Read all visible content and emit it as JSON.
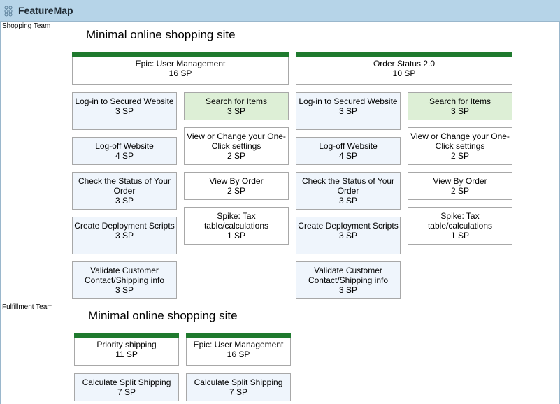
{
  "app": {
    "title": "FeatureMap",
    "icon": "featuremap-grid-icon"
  },
  "teams": [
    {
      "label": "Shopping Team",
      "release_title": "Minimal online shopping site",
      "epics": [
        {
          "name": "Epic: User Management",
          "sp": "16 SP",
          "left_column": [
            {
              "name": "Log-in to Secured Website",
              "sp": "3 SP"
            },
            {
              "name": "Log-off Website",
              "sp": "4 SP"
            },
            {
              "name": "Check the Status of Your Order",
              "sp": "3 SP"
            },
            {
              "name": "Create Deployment Scripts",
              "sp": "3 SP"
            },
            {
              "name": "Validate Customer Contact/Shipping info",
              "sp": "3 SP"
            }
          ],
          "right_column": [
            {
              "name": "Search for Items",
              "sp": "3 SP"
            },
            {
              "name": "View or Change your One-Click settings",
              "sp": "2 SP"
            },
            {
              "name": "View By Order",
              "sp": "2 SP"
            },
            {
              "name": "Spike: Tax table/calculations",
              "sp": "1 SP"
            }
          ]
        },
        {
          "name": "Order Status 2.0",
          "sp": "10 SP",
          "left_column": [
            {
              "name": "Log-in to Secured Website",
              "sp": "3 SP"
            },
            {
              "name": "Log-off Website",
              "sp": "4 SP"
            },
            {
              "name": "Check the Status of Your Order",
              "sp": "3 SP"
            },
            {
              "name": "Create Deployment Scripts",
              "sp": "3 SP"
            },
            {
              "name": "Validate Customer Contact/Shipping info",
              "sp": "3 SP"
            }
          ],
          "right_column": [
            {
              "name": "Search for Items",
              "sp": "3 SP"
            },
            {
              "name": "View or Change your One-Click settings",
              "sp": "2 SP"
            },
            {
              "name": "View By Order",
              "sp": "2 SP"
            },
            {
              "name": "Spike: Tax table/calculations",
              "sp": "1 SP"
            }
          ]
        }
      ]
    },
    {
      "label": "Fulfillment Team",
      "release_title": "Minimal online shopping site",
      "epics": [
        {
          "name": "Priority shipping",
          "sp": "11 SP",
          "stories": [
            {
              "name": "Calculate Split Shipping",
              "sp": "7 SP"
            }
          ]
        },
        {
          "name": "Epic: User Management",
          "sp": "16 SP",
          "stories": [
            {
              "name": "Calculate Split Shipping",
              "sp": "7 SP"
            }
          ]
        }
      ]
    }
  ],
  "colors": {
    "titlebar": "#b6d4e8",
    "epic_bar": "#1f7a2e",
    "story_fill": "#eff5fc",
    "search_fill": "#ddefd6",
    "card_border": "#a8a8a8"
  }
}
